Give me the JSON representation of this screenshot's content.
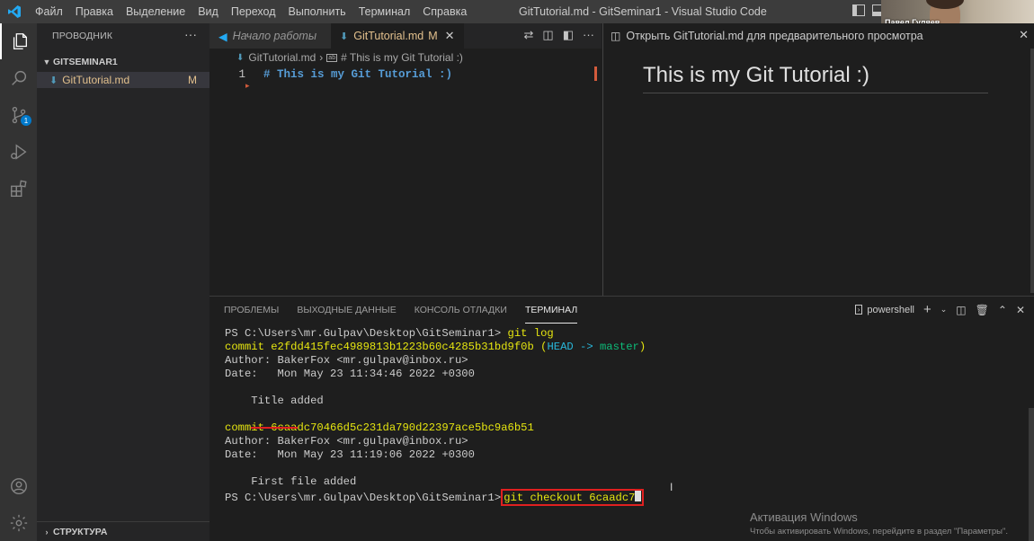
{
  "titlebar": {
    "menu": [
      "Файл",
      "Правка",
      "Выделение",
      "Вид",
      "Переход",
      "Выполнить",
      "Терминал",
      "Справка"
    ],
    "window_title": "GitTutorial.md - GitSeminar1 - Visual Studio Code",
    "webcam_name": "Павел Гуляев"
  },
  "activitybar": {
    "icons": [
      "explorer-icon",
      "search-icon",
      "source-control-icon",
      "run-debug-icon",
      "extensions-icon",
      "account-icon",
      "settings-gear-icon"
    ],
    "scm_badge": "1"
  },
  "sidebar": {
    "header": "ПРОВОДНИК",
    "more": "···",
    "workspace": "GITSEMINAR1",
    "file_name": "GitTutorial.md",
    "file_status": "M",
    "outline": "СТРУКТУРА"
  },
  "editor1": {
    "tab_inactive": "Начало работы",
    "tab_active": "GitTutorial.md",
    "tab_active_status": "M",
    "breadcrumb_file": "GitTutorial.md",
    "breadcrumb_symbol": "# This is my Git Tutorial :)",
    "line_number": "1",
    "line_code": "# This is my Git Tutorial :)"
  },
  "editor2": {
    "tab_label": "Открыть GitTutorial.md для предварительного просмотра",
    "heading": "This is my Git Tutorial :)"
  },
  "panel": {
    "tabs": [
      "ПРОБЛЕМЫ",
      "ВЫХОДНЫЕ ДАННЫЕ",
      "КОНСОЛЬ ОТЛАДКИ",
      "ТЕРМИНАЛ"
    ],
    "active_tab": "ТЕРМИНАЛ",
    "terminal_type": "powershell"
  },
  "terminal": {
    "prompt": "PS C:\\Users\\mr.Gulpav\\Desktop\\GitSeminar1>",
    "cmd1": "git log",
    "commit1_word": "commit",
    "commit1_hash": "e2fdd415fec4989813b1223b60c4285b31bd9f0b",
    "commit1_ref_open": "(",
    "commit1_head": "HEAD ->",
    "commit1_branch": "master",
    "commit1_ref_close": ")",
    "commit1_author": "Author: BakerFox <mr.gulpav@inbox.ru>",
    "commit1_date": "Date:   Mon May 23 11:34:46 2022 +0300",
    "commit1_msg": "    Title added",
    "commit2_word": "commit",
    "commit2_hash": "6caadc70466d5c231da790d22397ace5bc9a6b51",
    "commit2_author": "Author: BakerFox <mr.gulpav@inbox.ru>",
    "commit2_date": "Date:   Mon May 23 11:19:06 2022 +0300",
    "commit2_msg": "    First file added",
    "cmd2": "git checkout 6caadc7"
  },
  "watermark": {
    "title": "Активация Windows",
    "subtitle": "Чтобы активировать Windows, перейдите в раздел \"Параметры\"."
  },
  "colors": {
    "accent": "#007acc",
    "modified": "#e2c08d",
    "highlight_red": "#e02020",
    "terminal_yellow": "#e5e510",
    "terminal_cyan": "#29b8db",
    "terminal_green": "#0dbc79"
  }
}
